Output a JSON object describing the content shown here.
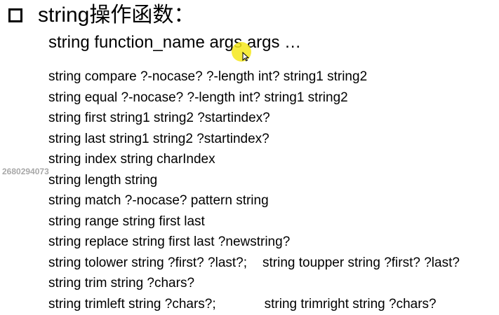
{
  "title": {
    "icon": "checkbox-icon",
    "text": "string操作函数："
  },
  "syntax": "string  function_name  args  args …",
  "functions": [
    {
      "text": "string compare ?-nocase? ?-length int? string1 string2"
    },
    {
      "text": "string equal ?-nocase? ?-length int? string1 string2"
    },
    {
      "text": "string first string1 string2 ?startindex?"
    },
    {
      "text": "string last string1 string2 ?startindex?"
    },
    {
      "text": "string index string charIndex"
    },
    {
      "text": "string length string"
    },
    {
      "text": "string match ?-nocase? pattern string"
    },
    {
      "text": "string range string first last"
    },
    {
      "text": "string replace string first last ?newstring?"
    },
    {
      "text": "string tolower string ?first? ?last?;",
      "second": "string toupper string ?first? ?last?"
    },
    {
      "text": "string trim string ?chars?"
    },
    {
      "text": "string trimleft string ?chars?;",
      "second": "string trimright string ?chars?"
    }
  ],
  "watermark": "2680294073",
  "cursor": {
    "highlight_color": "#f5e81c",
    "icon": "mouse-pointer-icon"
  }
}
